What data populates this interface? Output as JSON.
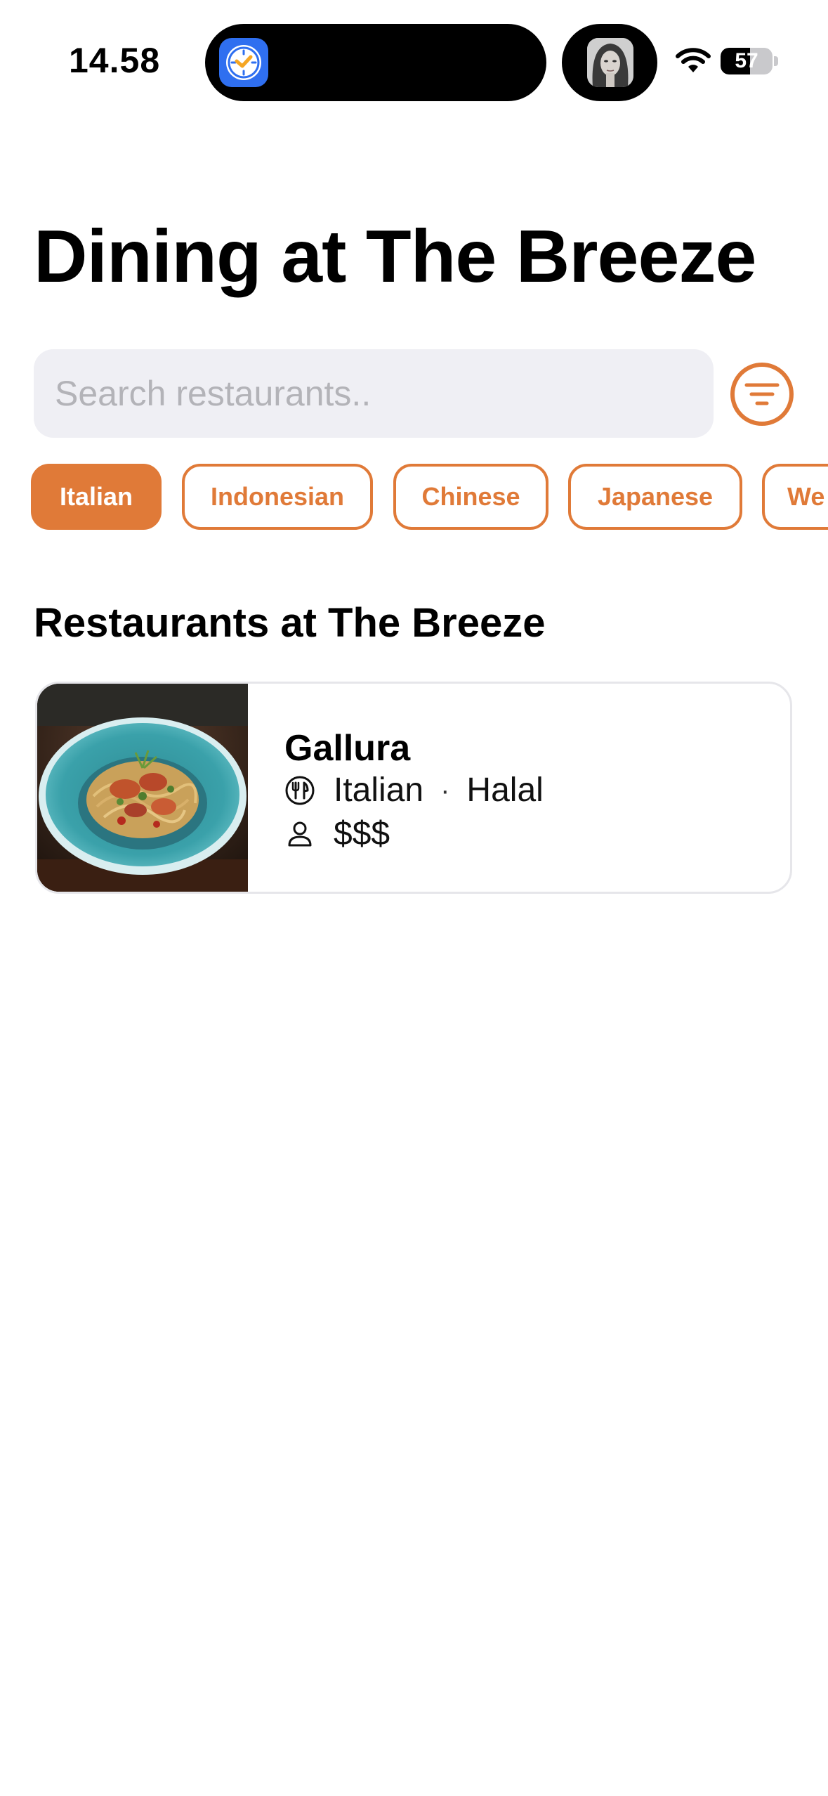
{
  "status_bar": {
    "time": "14.58",
    "battery": "57",
    "battery_level": 0.57,
    "wifi_icon": "wifi-icon",
    "island_app_icon": "clock-app-icon"
  },
  "header": {
    "title": "Dining at The Breeze"
  },
  "search": {
    "placeholder": "Search restaurants..",
    "value": "",
    "filter_icon": "filter-icon"
  },
  "categories": [
    {
      "label": "Italian",
      "active": true
    },
    {
      "label": "Indonesian",
      "active": false
    },
    {
      "label": "Chinese",
      "active": false
    },
    {
      "label": "Japanese",
      "active": false
    },
    {
      "label": "We",
      "active": false
    }
  ],
  "section": {
    "title": "Restaurants at The Breeze"
  },
  "restaurants": [
    {
      "name": "Gallura",
      "cuisine": "Italian",
      "separator": "·",
      "tag": "Halal",
      "price": "$$$",
      "cuisine_icon": "fork-knife-icon",
      "price_icon": "person-icon"
    }
  ],
  "colors": {
    "accent": "#e07a38",
    "search_background": "#efeff4",
    "card_border": "#e6e6ea"
  }
}
